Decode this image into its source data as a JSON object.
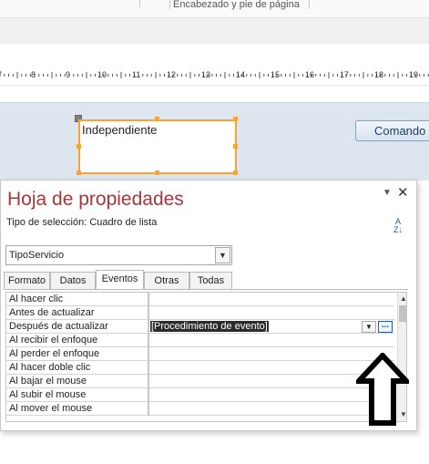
{
  "ribbon": {
    "group_label": "Encabezado y pie de página"
  },
  "ruler": {
    "numbers": [
      "7",
      "8",
      "9",
      "10",
      "11",
      "12",
      "13",
      "14",
      "15",
      "16",
      "17",
      "18",
      "19"
    ]
  },
  "design": {
    "selected_control_text": "Independiente",
    "command_button_label": "Comando"
  },
  "property_sheet": {
    "title": "Hoja de propiedades",
    "selection_type_label": "Tipo de selección:",
    "selection_type_value": "Cuadro de lista",
    "object_selector_value": "TipoServicio",
    "tabs": [
      {
        "label": "Formato",
        "active": false
      },
      {
        "label": "Datos",
        "active": false
      },
      {
        "label": "Eventos",
        "active": true
      },
      {
        "label": "Otras",
        "active": false
      },
      {
        "label": "Todas",
        "active": false
      }
    ],
    "rows": [
      {
        "label": "Al hacer clic",
        "value": ""
      },
      {
        "label": "Antes de actualizar",
        "value": ""
      },
      {
        "label": "Después de actualizar",
        "value": "[Procedimiento de evento]"
      },
      {
        "label": "Al recibir el enfoque",
        "value": ""
      },
      {
        "label": "Al perder el enfoque",
        "value": ""
      },
      {
        "label": "Al hacer doble clic",
        "value": ""
      },
      {
        "label": "Al bajar el mouse",
        "value": ""
      },
      {
        "label": "Al subir el mouse",
        "value": ""
      },
      {
        "label": "Al mover el mouse",
        "value": ""
      }
    ]
  },
  "colors": {
    "title": "#a4373a",
    "selection_outline": "#f5a43a",
    "canvas_bg": "#dde5ee",
    "arrow": "#000000"
  },
  "icons": [
    "sort-az-icon",
    "close-icon",
    "chevron-down-icon",
    "build-ellipsis-icon",
    "scroll-up-icon",
    "scroll-down-icon",
    "arrow-up-icon"
  ]
}
